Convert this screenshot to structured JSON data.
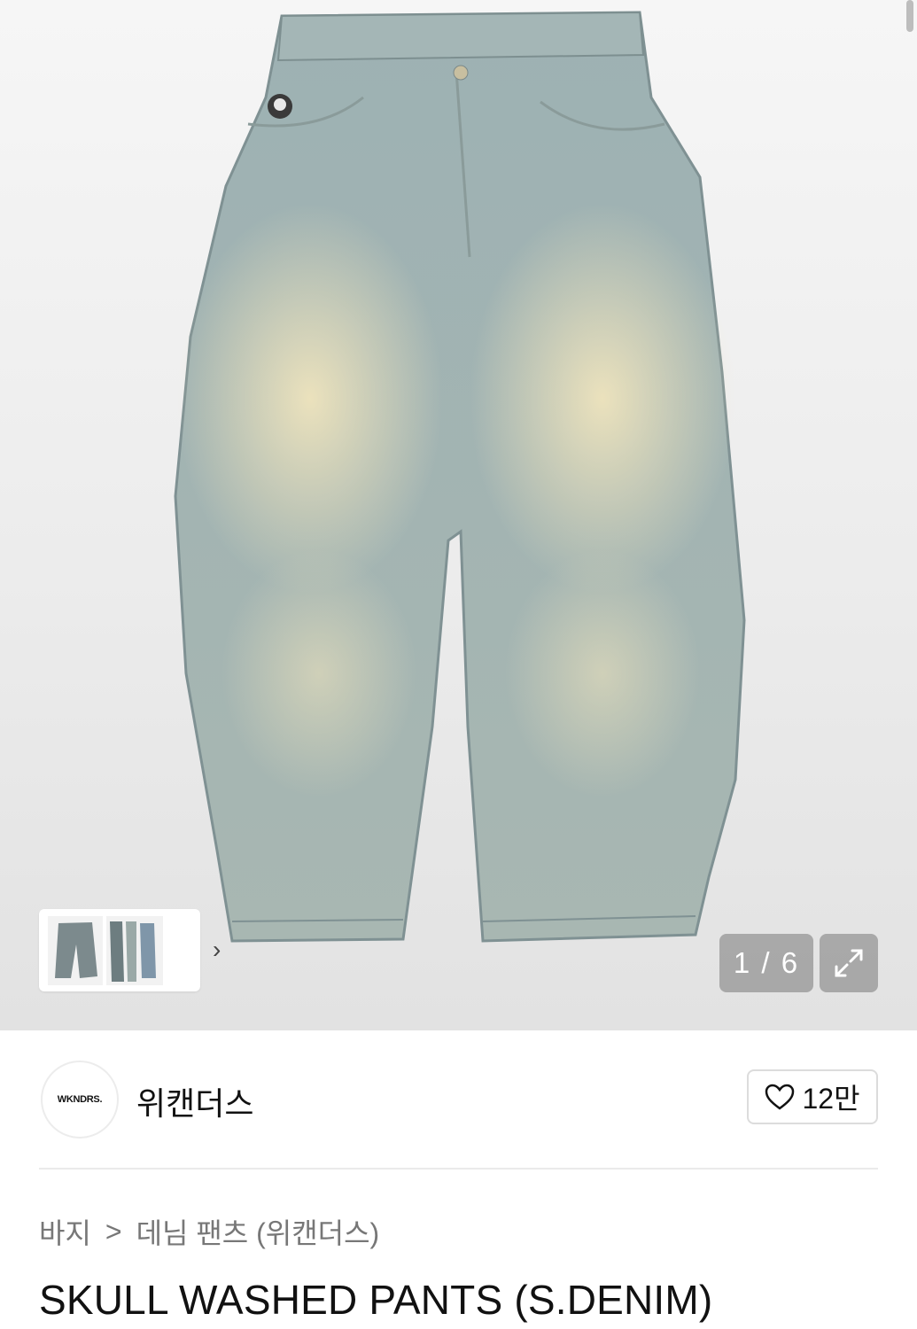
{
  "gallery": {
    "counter": "1 / 6",
    "thumbnail_next": "›"
  },
  "brand": {
    "logo_text": "WKNDRS.",
    "name": "위캔더스",
    "like_count": "12만"
  },
  "breadcrumb": {
    "category": "바지",
    "separator": ">",
    "subcategory": "데님 팬츠 (위캔더스)"
  },
  "product": {
    "title": "SKULL WASHED PANTS (S.DENIM)"
  },
  "colors": {
    "denim": "#9fb2b0",
    "fade": "#e6dcb6"
  }
}
